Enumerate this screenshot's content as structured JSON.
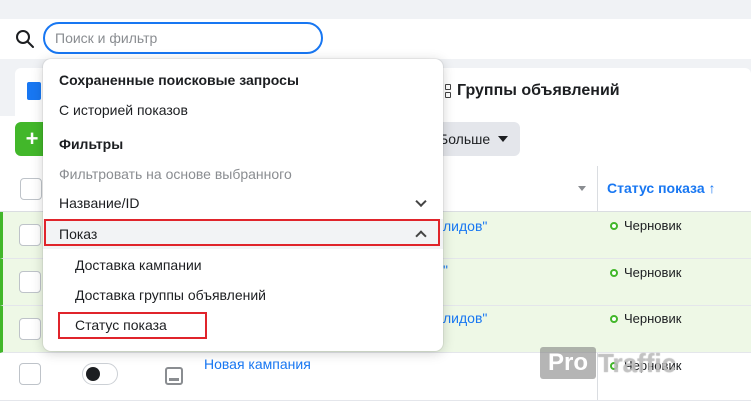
{
  "search": {
    "placeholder": "Поиск и фильтр",
    "value": ""
  },
  "tabs": {
    "adsets_label": "Группы объявлений"
  },
  "toolbar": {
    "create_label": "+",
    "more_label": "Больше"
  },
  "table": {
    "status_header": "Статус показа ↑",
    "rows": [
      {
        "link": "лидов\"",
        "status": "Черновик"
      },
      {
        "link": "\"",
        "status": "Черновик"
      },
      {
        "link": "лидов\"",
        "status": "Черновик"
      },
      {
        "link": "Новая кампания",
        "status": "Черновик"
      }
    ]
  },
  "dropdown": {
    "saved_heading": "Сохраненные поисковые запросы",
    "saved_item": "С историей показов",
    "filters_heading": "Фильтры",
    "filter_by_selected": "Фильтровать на основе выбранного",
    "name_id": "Название/ID",
    "delivery": "Показ",
    "delivery_sub": [
      "Доставка кампании",
      "Доставка группы объявлений",
      "Статус показа"
    ]
  },
  "watermark": {
    "pro": "Pro",
    "traffic": "Traffic"
  },
  "colors": {
    "accent": "#1877f2",
    "create_green": "#42b72a",
    "highlight_red": "#e0242b"
  }
}
